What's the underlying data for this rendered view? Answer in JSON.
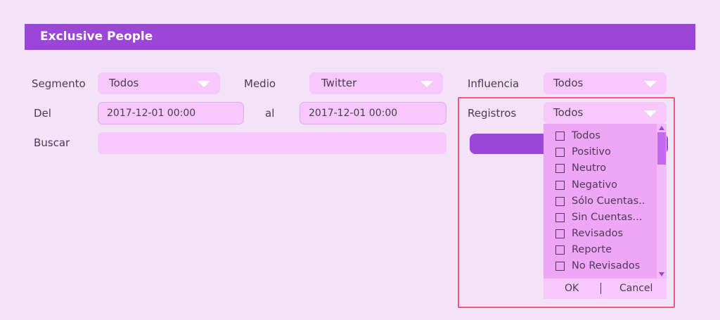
{
  "header": {
    "title": "Exclusive People"
  },
  "filters": {
    "segmento": {
      "label": "Segmento",
      "value": "Todos"
    },
    "medio": {
      "label": "Medio",
      "value": "Twitter"
    },
    "influencia": {
      "label": "Influencia",
      "value": "Todos"
    },
    "del": {
      "label": "Del",
      "value": "2017-12-01  00:00"
    },
    "al": {
      "label": "al",
      "value": "2017-12-01  00:00"
    },
    "registros": {
      "label": "Registros",
      "value": "Todos"
    },
    "buscar": {
      "label": "Buscar",
      "value": ""
    }
  },
  "registros_dropdown": {
    "options": [
      "Todos",
      "Positivo",
      "Neutro",
      "Negativo",
      "Sólo Cuentas..",
      "Sin Cuentas...",
      "Revisados",
      "Reporte",
      "No Revisados"
    ],
    "ok_label": "OK",
    "cancel_label": "Cancel"
  },
  "colors": {
    "accent": "#9b45d9",
    "field": "#f7c8fb",
    "highlight": "#f05a7a",
    "background": "#f2e3f8"
  }
}
